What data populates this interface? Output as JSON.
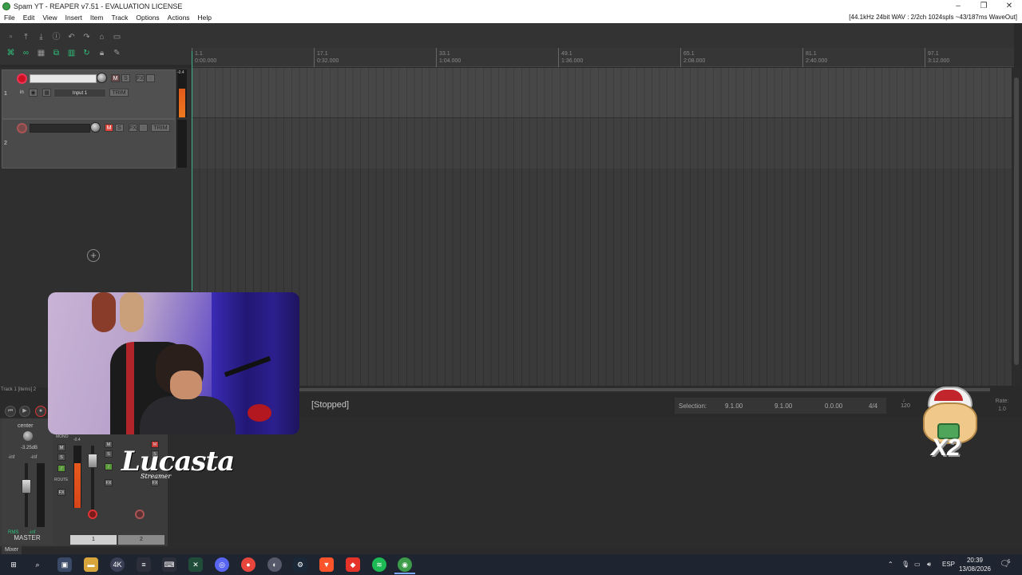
{
  "window": {
    "title": "Spam YT - REAPER v7.51 - EVALUATION LICENSE",
    "controls": [
      "–",
      "❐",
      "✕"
    ]
  },
  "menu": {
    "items": [
      "File",
      "Edit",
      "View",
      "Insert",
      "Item",
      "Track",
      "Options",
      "Actions",
      "Help"
    ],
    "audio_status": "[44.1kHz 24bit WAV : 2/2ch 1024spls ~43/187ms WaveOut]"
  },
  "ruler": {
    "marks": [
      {
        "bar": "1.1",
        "time": "0:00.000"
      },
      {
        "bar": "17.1",
        "time": "0:32.000"
      },
      {
        "bar": "33.1",
        "time": "1:04.000"
      },
      {
        "bar": "49.1",
        "time": "1:36.000"
      },
      {
        "bar": "65.1",
        "time": "2:08.000"
      },
      {
        "bar": "81.1",
        "time": "2:40.000"
      },
      {
        "bar": "97.1",
        "time": "3:12.000"
      }
    ]
  },
  "tracks": [
    {
      "number": "1",
      "input": "Input 1",
      "mute": "M",
      "solo": "S",
      "fx": "FX",
      "trim": "TRIM",
      "in": "in"
    },
    {
      "number": "2",
      "mute": "M",
      "solo": "S",
      "fx": "FX",
      "trim": "TRIM"
    }
  ],
  "tcp": {
    "meter_value": "-0.4",
    "items_label": "Track 1 [items] 2"
  },
  "transport": {
    "status": "[Stopped]",
    "selection_label": "Selection:",
    "selection_start": "9.1.00",
    "selection_end": "9.1.00",
    "selection_length": "0.0.00",
    "time_signature": "4/4",
    "tempo": "120",
    "rate_label": "Rate:",
    "rate_value": "1.0"
  },
  "mixer": {
    "master": {
      "label": "MASTER",
      "pan": "center",
      "volume_db": "-3.25dB",
      "inf_left": "-inf",
      "inf_right": "-inf",
      "rms": "RMS",
      "rms_value": "-inf",
      "mono": "MONO",
      "route": "ROUTE"
    },
    "strips": [
      {
        "number": "1",
        "peak": "-0.4"
      },
      {
        "number": "2"
      }
    ],
    "tab": "Mixer"
  },
  "overlay": {
    "logo": "Lucasta",
    "logo_sub": "Streamer",
    "badge": "X2"
  },
  "taskbar": {
    "language": "ESP",
    "time": "20:39",
    "date": "13/08/2026",
    "notifications": "5"
  },
  "colors": {
    "accent_green": "#2fc07a",
    "record_red": "#d9453c",
    "meter_orange": "#e65a1c",
    "arrange_bg": "#3a3a3a"
  }
}
